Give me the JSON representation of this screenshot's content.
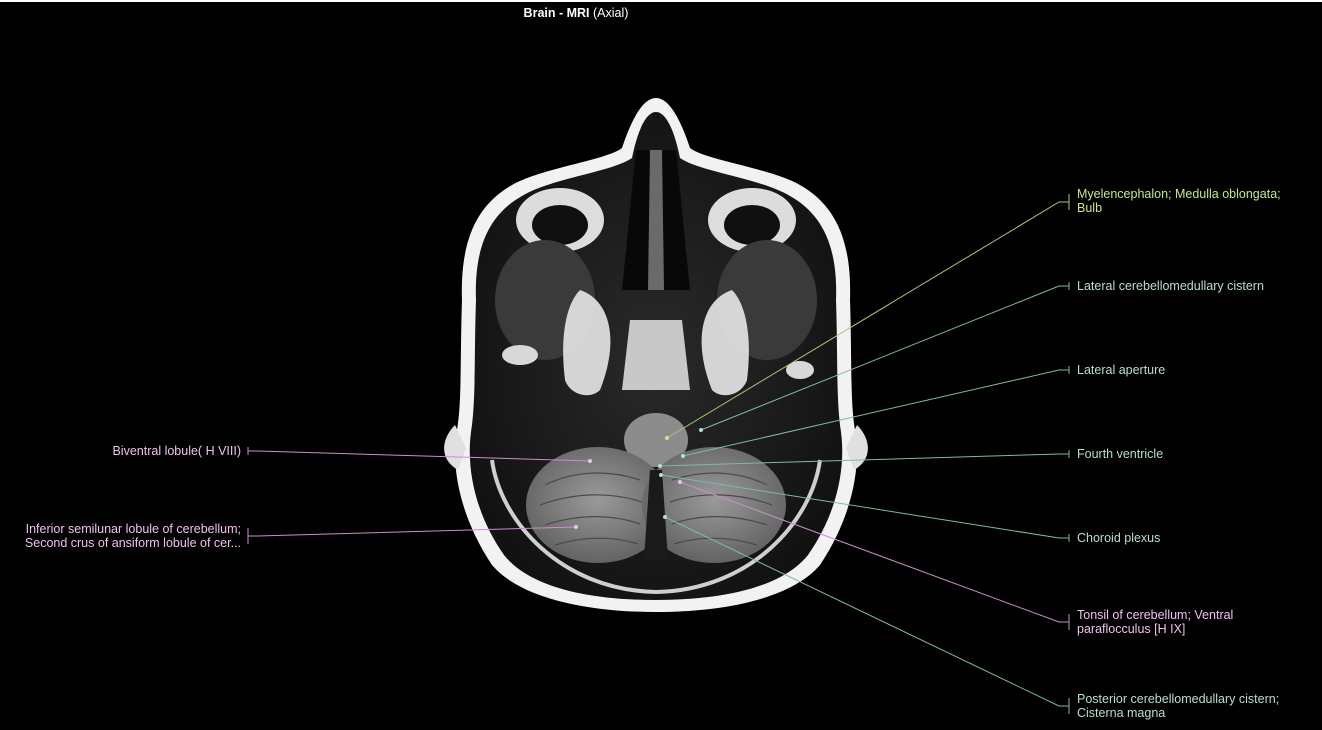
{
  "header": {
    "title_region": "Brain",
    "title_sep": " - ",
    "title_modality": "MRI",
    "title_view": " (Axial)"
  },
  "image": {
    "description_icon": "axial-brain-mri-icon"
  },
  "colors": {
    "green_label": "#c6e68c",
    "teal_label": "#b6ddd6",
    "pink_label": "#efc0ef",
    "green_line": "#a8c878",
    "teal_line": "#7fb8ac",
    "pink_line": "#c890c8"
  },
  "labels": {
    "right": [
      {
        "line1": "Myelencephalon; Medulla oblongata;",
        "line2": "Bulb",
        "color": "#c6e68c"
      },
      {
        "line1": "Lateral cerebellomedullary cistern",
        "line2": "",
        "color": "#b6ddd6"
      },
      {
        "line1": "Lateral aperture",
        "line2": "",
        "color": "#b6ddd6"
      },
      {
        "line1": "Fourth ventricle",
        "line2": "",
        "color": "#b6ddd6"
      },
      {
        "line1": "Choroid plexus",
        "line2": "",
        "color": "#b6ddd6"
      },
      {
        "line1": "Tonsil of cerebellum; Ventral",
        "line2": "paraflocculus [H IX]",
        "color": "#efc0ef"
      },
      {
        "line1": "Posterior cerebellomedullary cistern;",
        "line2": "Cisterna magna",
        "color": "#b6ddd6"
      }
    ],
    "left": [
      {
        "line1": "Biventral lobule( H VIII)",
        "line2": "",
        "color": "#efc0ef"
      },
      {
        "line1": "Inferior semilunar lobule of cerebellum;",
        "line2": "Second crus of ansiform lobule of cer...",
        "color": "#efc0ef"
      }
    ]
  }
}
